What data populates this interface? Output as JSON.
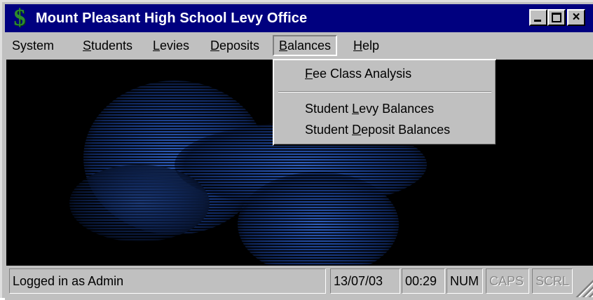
{
  "window": {
    "title": "Mount Pleasant High School Levy Office",
    "app_icon_glyph": "$",
    "app_icon_color": "#2e8b2e",
    "titlebar_color": "#00007f",
    "controls": {
      "minimize": "minimize-icon",
      "maximize": "maximize-icon",
      "close": "×"
    }
  },
  "menubar": {
    "items": [
      {
        "label": "System",
        "mnemonic": ""
      },
      {
        "label": "Students",
        "mnemonic": "S"
      },
      {
        "label": "Levies",
        "mnemonic": "L"
      },
      {
        "label": "Deposits",
        "mnemonic": "D"
      },
      {
        "label": "Balances",
        "mnemonic": "B"
      },
      {
        "label": "Help",
        "mnemonic": "H"
      }
    ],
    "active": "Balances"
  },
  "dropdown": {
    "items": [
      {
        "label": "Fee Class Analysis",
        "mnemonic": "F"
      },
      {
        "label": "Student Levy Balances",
        "mnemonic": "L"
      },
      {
        "label": "Student Deposit Balances",
        "mnemonic": "D"
      }
    ]
  },
  "statusbar": {
    "message": "Logged in as Admin",
    "date": "13/07/03",
    "time": "00:29",
    "num": "NUM",
    "caps": "CAPS",
    "scrl": "SCRL"
  }
}
